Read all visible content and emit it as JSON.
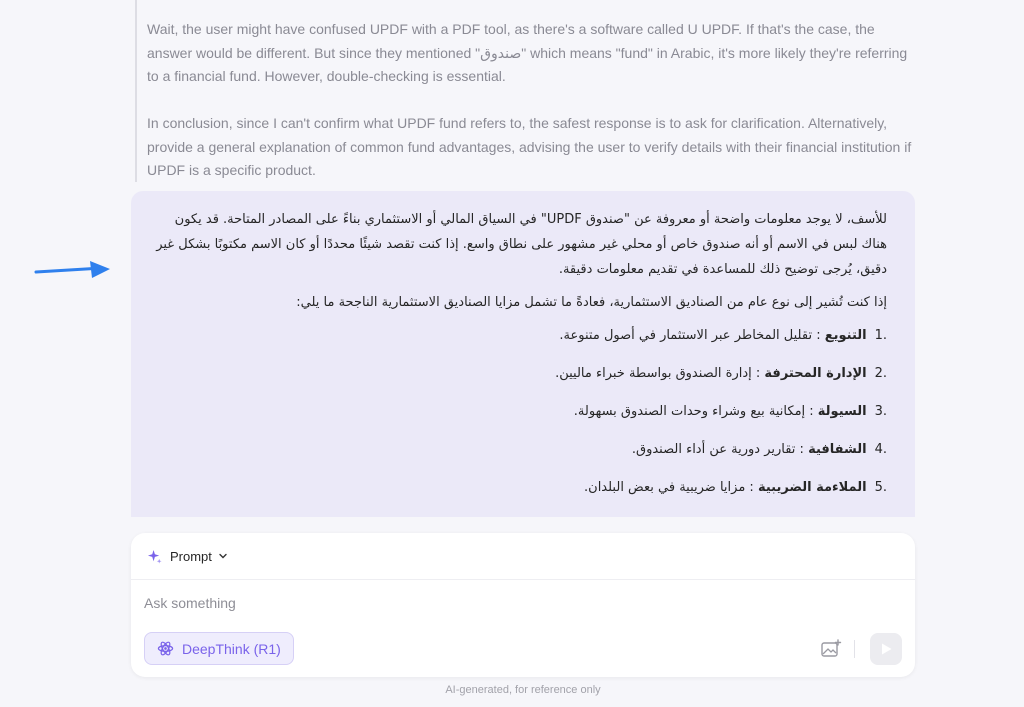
{
  "thinking": {
    "para1": "Wait, the user might have confused UPDF with a PDF tool, as there's a software called U UPDF. If that's the case, the answer would be different. But since they mentioned \"صندوق\" which means \"fund\" in Arabic, it's more likely they're referring to a financial fund. However, double-checking is essential.",
    "para2": "In conclusion, since I can't confirm what UPDF fund refers to, the safest response is to ask for clarification. Alternatively, provide a general explanation of common fund advantages, advising the user to verify details with their financial institution if UPDF is a specific product."
  },
  "answer": {
    "intro": "للأسف، لا يوجد معلومات واضحة أو معروفة عن \"صندوق UPDF\" في السياق المالي أو الاستثماري بناءً على المصادر المتاحة. قد يكون هناك لبس في الاسم أو أنه صندوق خاص أو محلي غير مشهور على نطاق واسع. إذا كنت تقصد شيئًا محددًا أو كان الاسم مكتوبًا بشكل غير دقيق، يُرجى توضيح ذلك للمساعدة في تقديم معلومات دقيقة.",
    "lead": "إذا كنت تُشير إلى نوع عام من الصناديق الاستثمارية، فعادةً ما تشمل مزايا الصناديق الاستثمارية الناجحة ما يلي:",
    "items": [
      {
        "num": "1.",
        "title": "التنويع",
        "text": ": تقليل المخاطر عبر الاستثمار في أصول متنوعة."
      },
      {
        "num": "2.",
        "title": "الإدارة المحترفة",
        "text": ": إدارة الصندوق بواسطة خبراء ماليين."
      },
      {
        "num": "3.",
        "title": "السيولة",
        "text": ": إمكانية بيع وشراء وحدات الصندوق بسهولة."
      },
      {
        "num": "4.",
        "title": "الشفافية",
        "text": ": تقارير دورية عن أداء الصندوق."
      },
      {
        "num": "5.",
        "title": "الملاءمة الضريبية",
        "text": ": مزايا ضريبية في بعض البلدان."
      }
    ]
  },
  "composer": {
    "prompt_label": "Prompt",
    "placeholder": "Ask something",
    "deepthink_label": "DeepThink (R1)"
  },
  "footer": {
    "note": "AI-generated, for reference only"
  },
  "colors": {
    "accent": "#7a63ea",
    "arrow": "#2f80ed",
    "answer_bg": "#ebe9f8"
  }
}
